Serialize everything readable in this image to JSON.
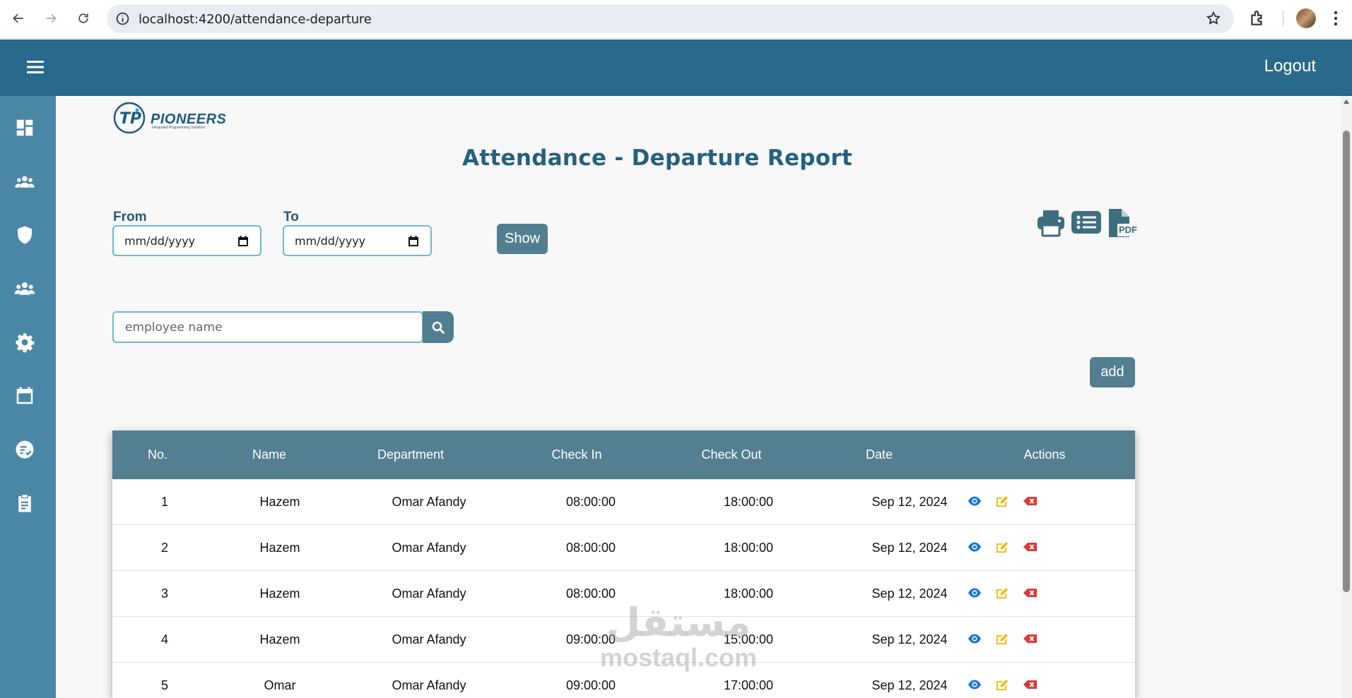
{
  "browser": {
    "url": "localhost:4200/attendance-departure"
  },
  "header": {
    "logout_label": "Logout"
  },
  "sidebar": {
    "items": [
      {
        "icon": "dashboard-icon"
      },
      {
        "icon": "users-group-icon"
      },
      {
        "icon": "shield-icon"
      },
      {
        "icon": "employees-icon"
      },
      {
        "icon": "gear-icon"
      },
      {
        "icon": "calendar-icon"
      },
      {
        "icon": "check-list-icon"
      },
      {
        "icon": "clipboard-icon"
      }
    ]
  },
  "logo": {
    "name": "PIONEERS",
    "tagline": "Integrated Programming Solutions"
  },
  "page": {
    "title": "Attendance - Departure Report"
  },
  "filters": {
    "from_label": "From",
    "to_label": "To",
    "from_value": "mm/dd/yyyy",
    "to_value": "mm/dd/yyyy",
    "show_label": "Show",
    "search_placeholder": "employee name",
    "add_label": "add"
  },
  "toolbar": {
    "icons": [
      "print-icon",
      "list-icon",
      "pdf-icon"
    ],
    "pdf_text": "PDF"
  },
  "table": {
    "columns": [
      "No.",
      "Name",
      "Department",
      "Check In",
      "Check Out",
      "Date",
      "Actions"
    ],
    "rows": [
      {
        "no": "1",
        "name": "Hazem",
        "department": "Omar Afandy",
        "check_in": "08:00:00",
        "check_out": "18:00:00",
        "date": "Sep 12, 2024"
      },
      {
        "no": "2",
        "name": "Hazem",
        "department": "Omar Afandy",
        "check_in": "08:00:00",
        "check_out": "18:00:00",
        "date": "Sep 12, 2024"
      },
      {
        "no": "3",
        "name": "Hazem",
        "department": "Omar Afandy",
        "check_in": "08:00:00",
        "check_out": "18:00:00",
        "date": "Sep 12, 2024"
      },
      {
        "no": "4",
        "name": "Hazem",
        "department": "Omar Afandy",
        "check_in": "09:00:00",
        "check_out": "15:00:00",
        "date": "Sep 12, 2024"
      },
      {
        "no": "5",
        "name": "Omar",
        "department": "Omar Afandy",
        "check_in": "09:00:00",
        "check_out": "17:00:00",
        "date": "Sep 12, 2024"
      }
    ],
    "action_icons": [
      "eye-icon",
      "edit-icon",
      "delete-icon"
    ]
  },
  "colors": {
    "header": "#29698b",
    "sidebar": "#4a87a6",
    "title": "#25607f",
    "table_header": "#537f90",
    "button": "#527f90",
    "view": "#1a73e8",
    "edit": "#f2b705",
    "delete": "#d93a3a"
  },
  "watermark": {
    "arabic": "مستقل",
    "latin": "mostaql.com"
  }
}
